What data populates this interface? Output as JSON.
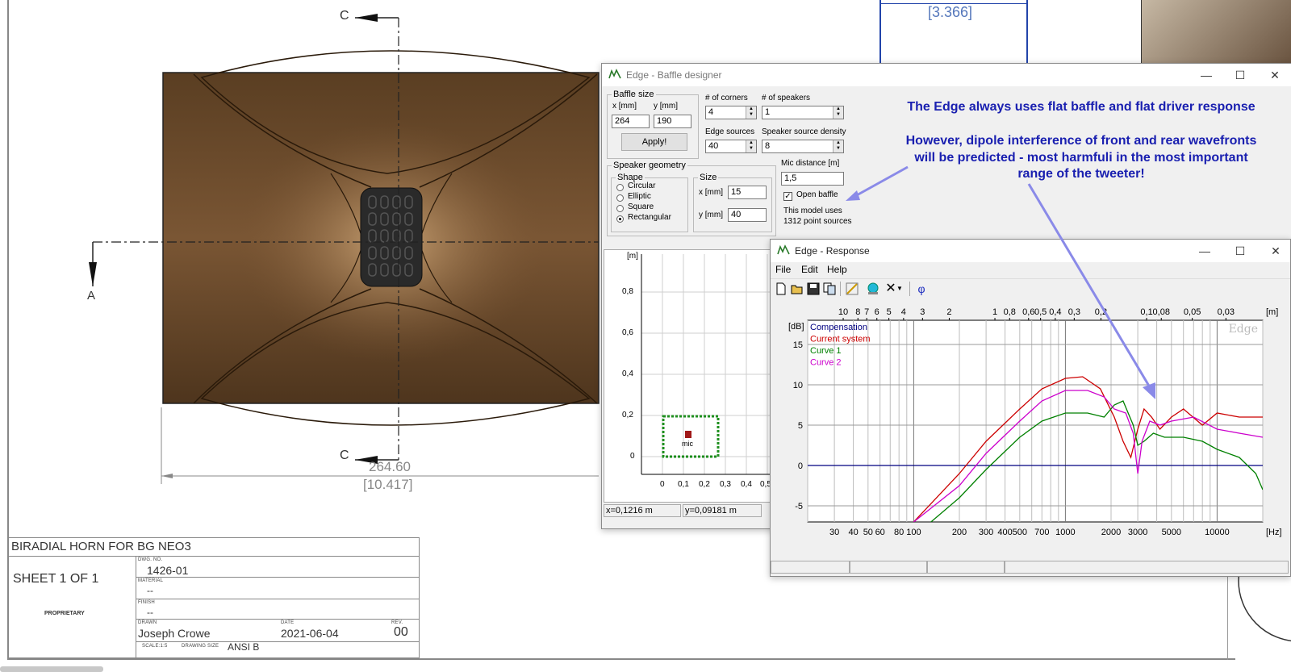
{
  "drawing": {
    "section_top": "C",
    "section_bottom": "C",
    "section_left": "A",
    "dim_top": "[3.366]",
    "dim_mm": "264.60",
    "dim_in": "[10.417]",
    "title_block": {
      "title": "BIRADIAL HORN FOR BG NEO3",
      "sheet": "SHEET 1 OF 1",
      "proprietary": "PROPRIETARY",
      "dwg_no_label": "DWG. NO.",
      "dwg_no": "1426-01",
      "material_label": "MATERIAL",
      "material": "--",
      "finish_label": "FINISH",
      "finish": "--",
      "drawn_label": "DRAWN",
      "drawn": "Joseph Crowe",
      "date_label": "DATE",
      "date": "2021-06-04",
      "rev_label": "REV.",
      "rev": "00",
      "scale_label": "SCALE:1:5",
      "drawing_size_label": "DRAWING SIZE",
      "drawing_size": "ANSI B"
    }
  },
  "baffle_window": {
    "title": "Edge - Baffle designer",
    "baffle_size_label": "Baffle size",
    "x_label": "x [mm]",
    "y_label": "y [mm]",
    "x_value": "264",
    "y_value": "190",
    "apply_label": "Apply!",
    "corners_label": "# of corners",
    "corners_value": "4",
    "speakers_label": "# of speakers",
    "speakers_value": "1",
    "edge_sources_label": "Edge sources",
    "edge_sources_value": "40",
    "density_label": "Speaker source density",
    "density_value": "8",
    "geometry_label": "Speaker geometry",
    "shape_label": "Shape",
    "shapes": [
      "Circular",
      "Elliptic",
      "Square",
      "Rectangular"
    ],
    "selected_shape": "Rectangular",
    "size_label": "Size",
    "size_x_label": "x [mm]",
    "size_x_value": "15",
    "size_y_label": "y [mm]",
    "size_y_value": "40",
    "mic_label": "Mic distance [m]",
    "mic_value": "1,5",
    "open_baffle_label": "Open baffle",
    "open_baffle_checked": true,
    "model_info_1": "This model uses",
    "model_info_2": "1312 point sources",
    "plot": {
      "unit": "[m]",
      "y_ticks": [
        "0,8",
        "0,6",
        "0,4",
        "0,2",
        "0"
      ],
      "x_ticks": [
        "0",
        "0,1",
        "0,2",
        "0,3",
        "0,4",
        "0,5"
      ],
      "mic_text": "mic"
    },
    "status_x": "x=0,1216 m",
    "status_y": "y=0,09181 m"
  },
  "response_window": {
    "title": "Edge - Response",
    "menu": [
      "File",
      "Edit",
      "Help"
    ],
    "toolbar_icons": [
      "new-icon",
      "open-icon",
      "save-icon",
      "copy-icon",
      "edit-curve-icon",
      "globe-icon",
      "delete-icon",
      "dropdown-icon",
      "phase-icon"
    ],
    "phase_symbol": "φ",
    "delete_symbol": "✕"
  },
  "chart_data": {
    "type": "line",
    "ylabel": "[dB]",
    "xlabel": "[Hz]",
    "top_axis_unit": "[m]",
    "watermark": "Edge",
    "ylim": [
      -7,
      18
    ],
    "xlim": [
      20,
      20000
    ],
    "x_scale": "log",
    "y_ticks": [
      "15",
      "10",
      "5",
      "0",
      "-5"
    ],
    "y_tick_values": [
      15,
      10,
      5,
      0,
      -5
    ],
    "x_ticks": [
      "30",
      "40",
      "50",
      "60",
      "80",
      "100",
      "200",
      "300",
      "400",
      "500",
      "700",
      "1000",
      "2000",
      "3000",
      "5000",
      "10000"
    ],
    "x_tick_values": [
      30,
      40,
      50,
      60,
      80,
      100,
      200,
      300,
      400,
      500,
      700,
      1000,
      2000,
      3000,
      5000,
      10000
    ],
    "top_ticks": [
      "10",
      "8",
      "7",
      "6",
      "5",
      "4",
      "3",
      "2",
      "1",
      "0,8",
      "0,6",
      "0,5",
      "0,4",
      "0,3",
      "0,2",
      "0,1",
      "0,08",
      "0,05",
      "0,03"
    ],
    "top_tick_values": [
      10,
      8,
      7,
      6,
      5,
      4,
      3,
      2,
      1,
      0.8,
      0.6,
      0.5,
      0.4,
      0.3,
      0.2,
      0.1,
      0.08,
      0.05,
      0.03
    ],
    "grid": true,
    "legend": "top-left",
    "series": [
      {
        "name": "Compensation",
        "color": "#000080",
        "x": [
          20,
          20000
        ],
        "y": [
          0,
          0
        ]
      },
      {
        "name": "Current system",
        "color": "#cc0000",
        "x": [
          100,
          200,
          300,
          500,
          700,
          1000,
          1300,
          1700,
          2100,
          2400,
          2700,
          3000,
          3300,
          3700,
          4200,
          5000,
          6000,
          8000,
          10000,
          14000,
          20000
        ],
        "y": [
          -7,
          -1,
          3,
          7,
          9.5,
          10.8,
          11,
          9.5,
          6,
          3,
          1,
          4.5,
          7,
          6,
          4.5,
          6,
          7,
          5,
          6.5,
          6,
          6
        ]
      },
      {
        "name": "Curve 1",
        "color": "#008000",
        "x": [
          130,
          200,
          300,
          500,
          700,
          1000,
          1400,
          1800,
          2100,
          2400,
          2800,
          3000,
          3300,
          3800,
          4500,
          6000,
          8000,
          10000,
          14000,
          18000,
          20000
        ],
        "y": [
          -7,
          -4,
          -0.5,
          3.5,
          5.5,
          6.5,
          6.5,
          6,
          7.5,
          8,
          5,
          2.5,
          3,
          4,
          3.5,
          3.5,
          3,
          2,
          1,
          -1,
          -3
        ]
      },
      {
        "name": "Curve 2",
        "color": "#cc00cc",
        "x": [
          100,
          200,
          300,
          500,
          700,
          1000,
          1400,
          1800,
          2100,
          2500,
          2800,
          3000,
          3200,
          3600,
          4200,
          5000,
          7000,
          10000,
          14000,
          20000
        ],
        "y": [
          -7,
          -2.5,
          1.5,
          5.5,
          8,
          9.3,
          9.3,
          8.5,
          7,
          6.5,
          4,
          -1,
          3,
          5.5,
          5,
          5.5,
          6,
          4.5,
          4,
          3.5
        ]
      }
    ]
  },
  "annotations": {
    "line1": "The Edge always uses flat baffle and flat driver response",
    "line2": "However, dipole interference of front and rear wavefronts",
    "line3": "will be predicted - most harmfuli in the most important",
    "line4": "range of the tweeter!"
  },
  "colors": {
    "annotation_text": "#1a20b0",
    "annotation_arrow": "#8a8ae8",
    "wood": "#6b4a2b",
    "mic_box": "#1f8f1f"
  }
}
